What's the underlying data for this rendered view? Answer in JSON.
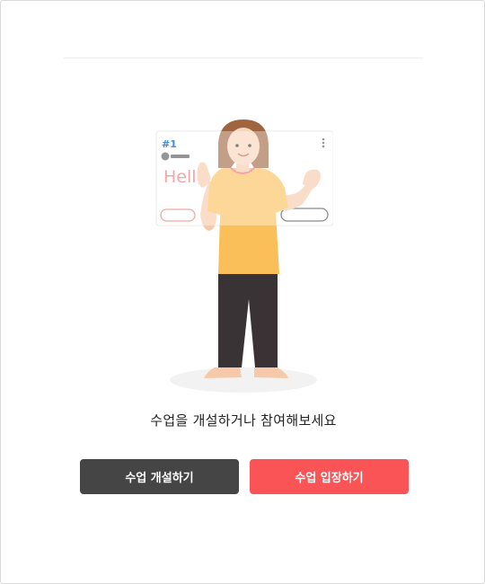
{
  "illustration": {
    "card_number": "#1",
    "card_text": "Hello"
  },
  "prompt_text": "수업을 개설하거나 참여해보세요",
  "buttons": {
    "create_label": "수업 개설하기",
    "join_label": "수업 입장하기"
  },
  "colors": {
    "create_button": "#454545",
    "join_button": "#fb5456",
    "card_number_blue": "#4a90d9",
    "shirt_yellow": "#fbbf5a",
    "pants_dark": "#3a3336"
  }
}
